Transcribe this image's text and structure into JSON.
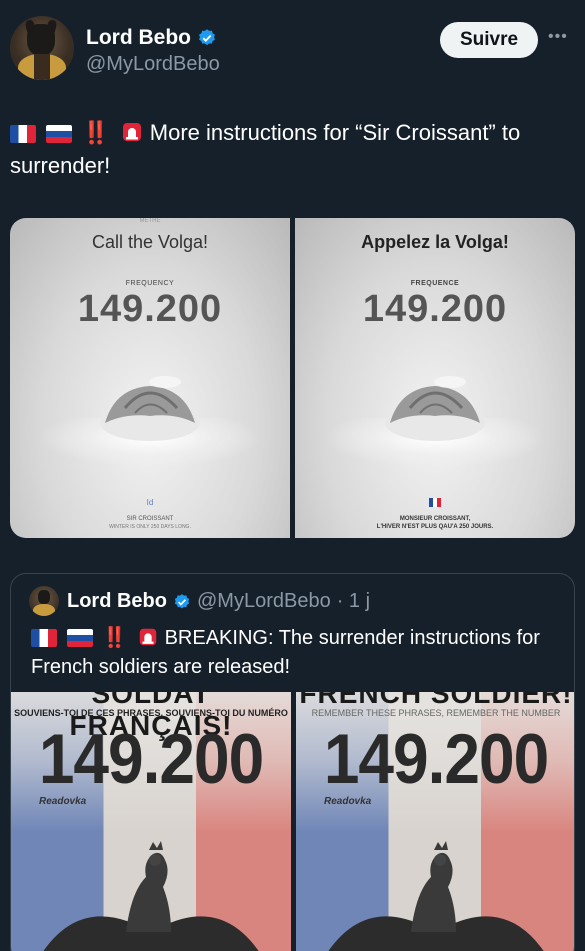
{
  "tweet": {
    "author": {
      "name": "Lord Bebo",
      "handle": "@MyLordBebo"
    },
    "follow_label": "Suivre",
    "more_label": "•••",
    "emoji": [
      "flag-france",
      "flag-russia",
      "double-exclamation",
      "rotating-light"
    ],
    "bang": "‼️",
    "text_line": "More instructions for “Sir Croissant” to surrender!"
  },
  "media": {
    "left": {
      "top": "METHE",
      "title": "Call the Volga!",
      "freq_label": "FREQUENCY",
      "number": "149.200",
      "logo": "Id",
      "foot1": "SIR CROISSANT",
      "foot2": "WINTER IS ONLY 250 DAYS LONG."
    },
    "right": {
      "title": "Appelez la Volga!",
      "freq_label": "FREQUENCE",
      "number": "149.200",
      "foot1": "MONSIEUR CROISSANT,",
      "foot2": "L'HIVER N'EST PLUS QAU'A 250 JOURS."
    }
  },
  "quote": {
    "author": {
      "name": "Lord Bebo",
      "handle": "@MyLordBebo",
      "time": "· 1 j"
    },
    "bang": "‼️",
    "text": "BREAKING: The surrender instructions for French soldiers are released!",
    "posters": [
      {
        "headline": "SOLDAT FRANÇAIS!",
        "subline": "SOUVIENS-TOI DE CES PHRASES, SOUVIENS-TOI DU NUMÉRO",
        "number": "149.200",
        "brand": "Readovka"
      },
      {
        "headline": "FRENCH SOLDIER!",
        "subline": "REMEMBER THESE PHRASES, REMEMBER THE NUMBER",
        "number": "149.200",
        "brand": "Readovka"
      }
    ]
  },
  "colors": {
    "background": "#15202b",
    "verified": "#1d9bf0",
    "muted": "#8b98a5",
    "button_bg": "#eff3f4"
  }
}
